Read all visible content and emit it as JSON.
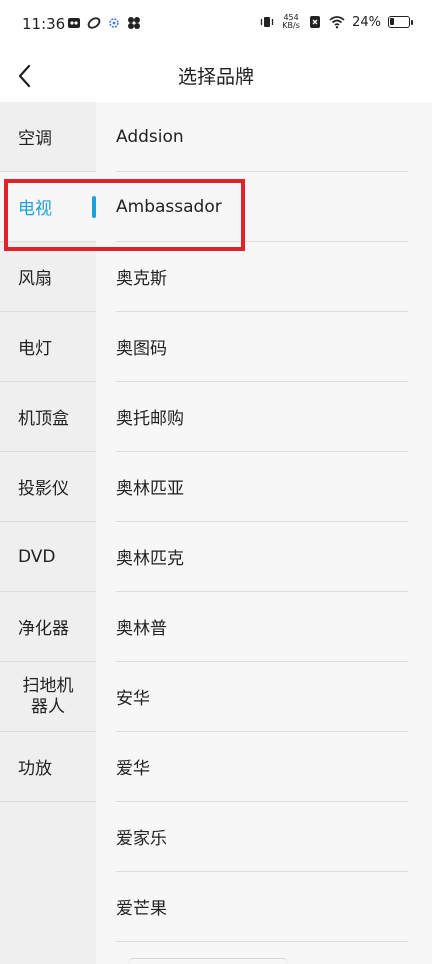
{
  "status_bar": {
    "time": "11:36",
    "net_speed_value": "454",
    "net_speed_unit": "KB/s",
    "battery": "24%",
    "battery_level": 0.24
  },
  "header": {
    "title": "选择品牌",
    "back_icon": "chevron-left-icon"
  },
  "categories": [
    {
      "label": "空调",
      "active": false
    },
    {
      "label": "电视",
      "active": true
    },
    {
      "label": "风扇",
      "active": false
    },
    {
      "label": "电灯",
      "active": false
    },
    {
      "label": "机顶盒",
      "active": false
    },
    {
      "label": "投影仪",
      "active": false
    },
    {
      "label": "DVD",
      "active": false
    },
    {
      "label": "净化器",
      "active": false
    },
    {
      "label": "扫地机器人",
      "line1": "扫地机",
      "line2": "器人",
      "active": false
    },
    {
      "label": "功放",
      "active": false
    }
  ],
  "brands": [
    "Addsion",
    "Ambassador",
    "奥克斯",
    "奥图码",
    "奥托邮购",
    "奥林匹亚",
    "奥林匹克",
    "奥林普",
    "安华",
    "爱华",
    "爱家乐",
    "爱芒果"
  ],
  "colors": {
    "accent": "#1e9fd9",
    "highlight": "#e0222b"
  }
}
